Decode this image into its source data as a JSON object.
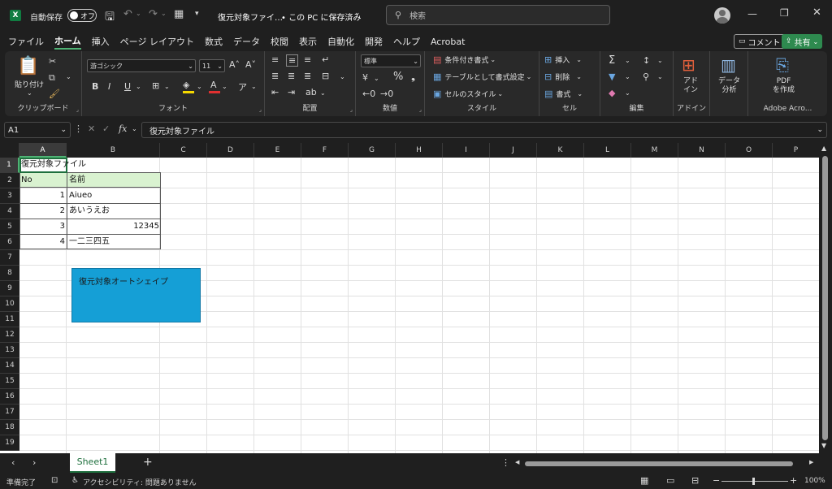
{
  "app": {
    "logo": "X",
    "autosave_label": "自動保存",
    "autosave_state": "オフ",
    "filename": "復元対象ファイ…",
    "save_status": "• この PC に保存済み",
    "search_placeholder": "検索",
    "colors": {
      "accent": "#107c41",
      "selection": "#4fb375",
      "shape_fill": "#159fd6",
      "share": "#2e8a4f"
    }
  },
  "menu": {
    "tabs": [
      "ファイル",
      "ホーム",
      "挿入",
      "ページ レイアウト",
      "数式",
      "データ",
      "校閲",
      "表示",
      "自動化",
      "開発",
      "ヘルプ",
      "Acrobat"
    ],
    "active": "ホーム",
    "comment": "コメント",
    "share": "共有"
  },
  "ribbon": {
    "clipboard": {
      "label": "クリップボード",
      "paste": "貼り付け"
    },
    "font": {
      "label": "フォント",
      "name": "游ゴシック",
      "size": "11",
      "bold": "B",
      "italic": "I",
      "underline": "U"
    },
    "alignment": {
      "label": "配置"
    },
    "number": {
      "label": "数値",
      "format": "標準"
    },
    "styles": {
      "label": "スタイル",
      "conditional": "条件付き書式",
      "table": "テーブルとして書式設定",
      "cell": "セルのスタイル"
    },
    "cells": {
      "label": "セル",
      "insert": "挿入",
      "delete": "削除",
      "format": "書式"
    },
    "editing": {
      "label": "編集"
    },
    "addins": {
      "label": "アドイン",
      "button": "アド\nイン"
    },
    "analysis": {
      "button": "データ\n分析"
    },
    "adobe": {
      "label": "Adobe Acro...",
      "button": "PDF\nを作成"
    }
  },
  "formula": {
    "namebox": "A1",
    "content": "復元対象ファイル"
  },
  "grid": {
    "columns": [
      "A",
      "B",
      "C",
      "D",
      "E",
      "F",
      "G",
      "H",
      "I",
      "J",
      "K",
      "L",
      "M",
      "N",
      "O",
      "P"
    ],
    "rows": [
      "1",
      "2",
      "3",
      "4",
      "5",
      "6",
      "7",
      "8",
      "9",
      "10",
      "11",
      "12",
      "13",
      "14",
      "15",
      "16",
      "17",
      "18",
      "19"
    ],
    "cells": {
      "A1": "復元対象ファイル",
      "A2": "No",
      "B2": "名前",
      "A3": "1",
      "B3": "Aiueo",
      "A4": "2",
      "B4": "あいうえお",
      "A5": "3",
      "B5": "12345",
      "A6": "4",
      "B6": "一二三四五"
    }
  },
  "shape": {
    "text": "復元対象オートシェイプ"
  },
  "sheets": {
    "tabs": [
      "Sheet1"
    ],
    "add": "+"
  },
  "status": {
    "ready": "準備完了",
    "accessibility": "アクセシビリティ: 問題ありません",
    "zoom": "100%"
  }
}
